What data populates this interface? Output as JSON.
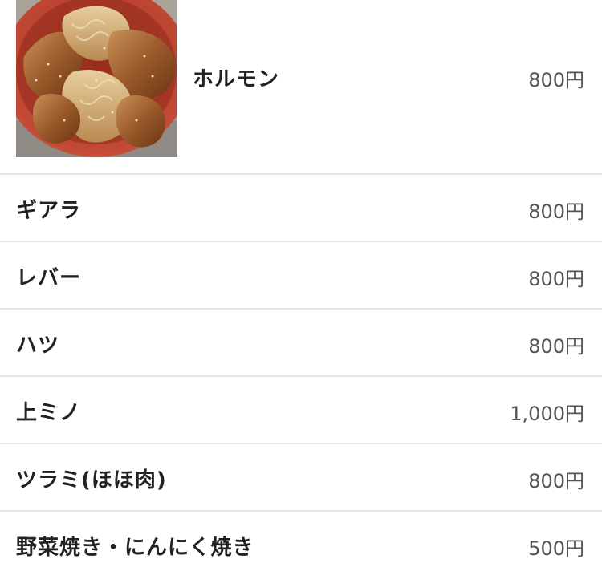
{
  "menu": {
    "featured": {
      "name": "ホルモン",
      "price": "800円",
      "photo_icon": "grilled-offal-photo"
    },
    "items": [
      {
        "name": "ギアラ",
        "price": "800円"
      },
      {
        "name": "レバー",
        "price": "800円"
      },
      {
        "name": "ハツ",
        "price": "800円"
      },
      {
        "name": "上ミノ",
        "price": "1,000円"
      },
      {
        "name": "ツラミ(ほほ肉)",
        "price": "800円"
      },
      {
        "name": "野菜焼き・にんにく焼き",
        "price": "500円"
      }
    ]
  },
  "colors": {
    "divider": "#e3e3e3",
    "price_text": "#555555",
    "name_text": "#222222",
    "plate": "#c0392b",
    "meat": "#8a4a1e"
  }
}
